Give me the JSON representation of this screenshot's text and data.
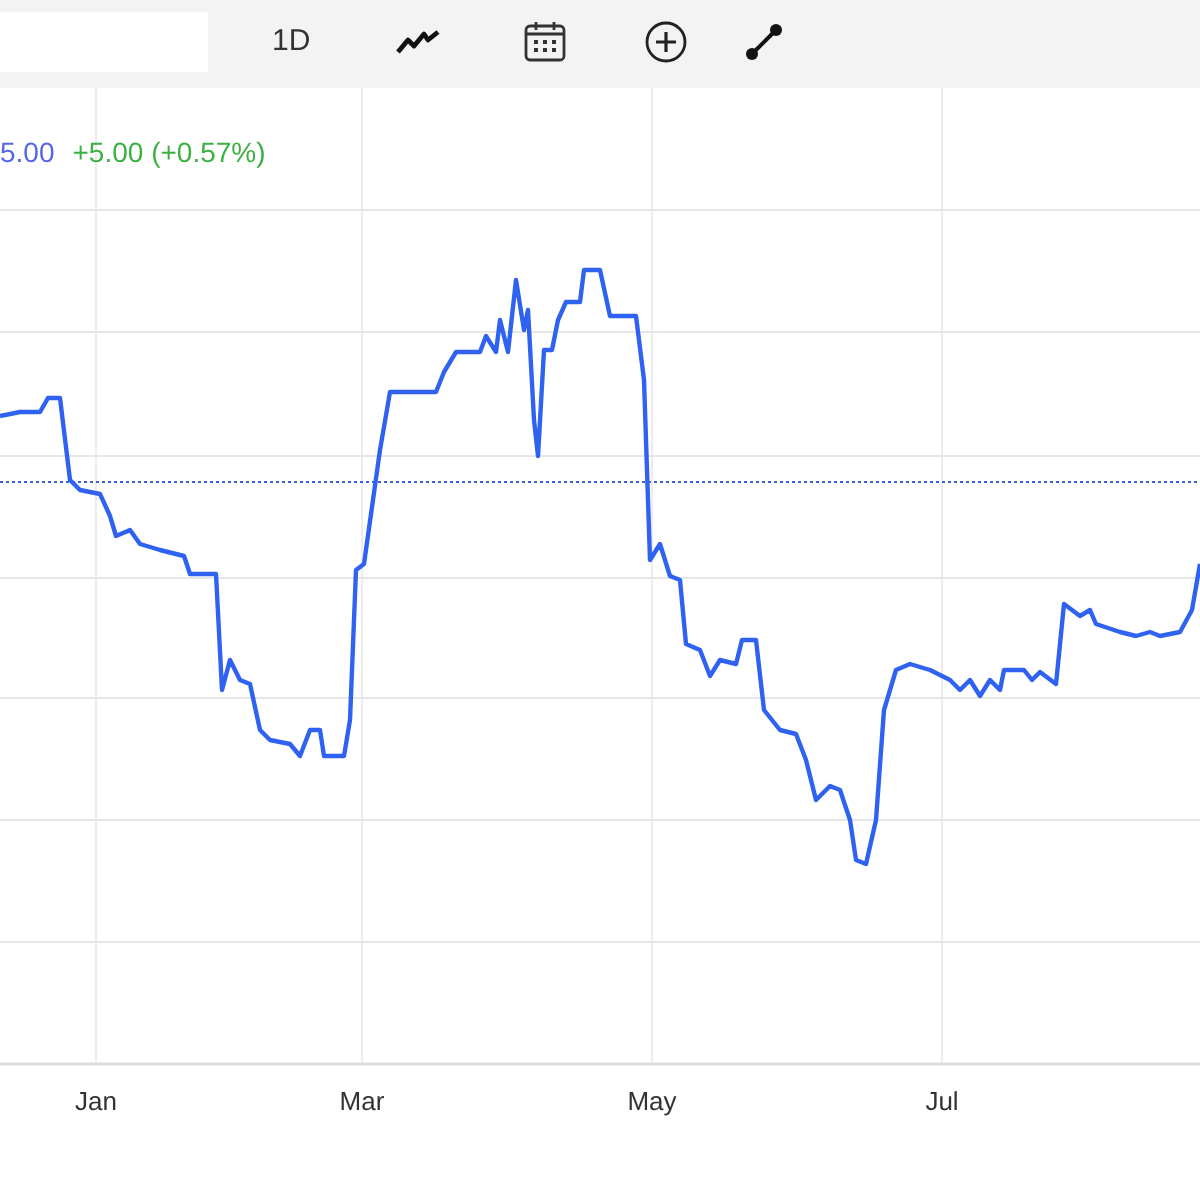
{
  "toolbar": {
    "interval": "1D"
  },
  "legend": {
    "price": "5.00",
    "change": "+5.00 (+0.57%)"
  },
  "chart": {
    "kind": "picture",
    "x_labels": [
      "Jan",
      "Mar",
      "May",
      "Jul"
    ]
  }
}
